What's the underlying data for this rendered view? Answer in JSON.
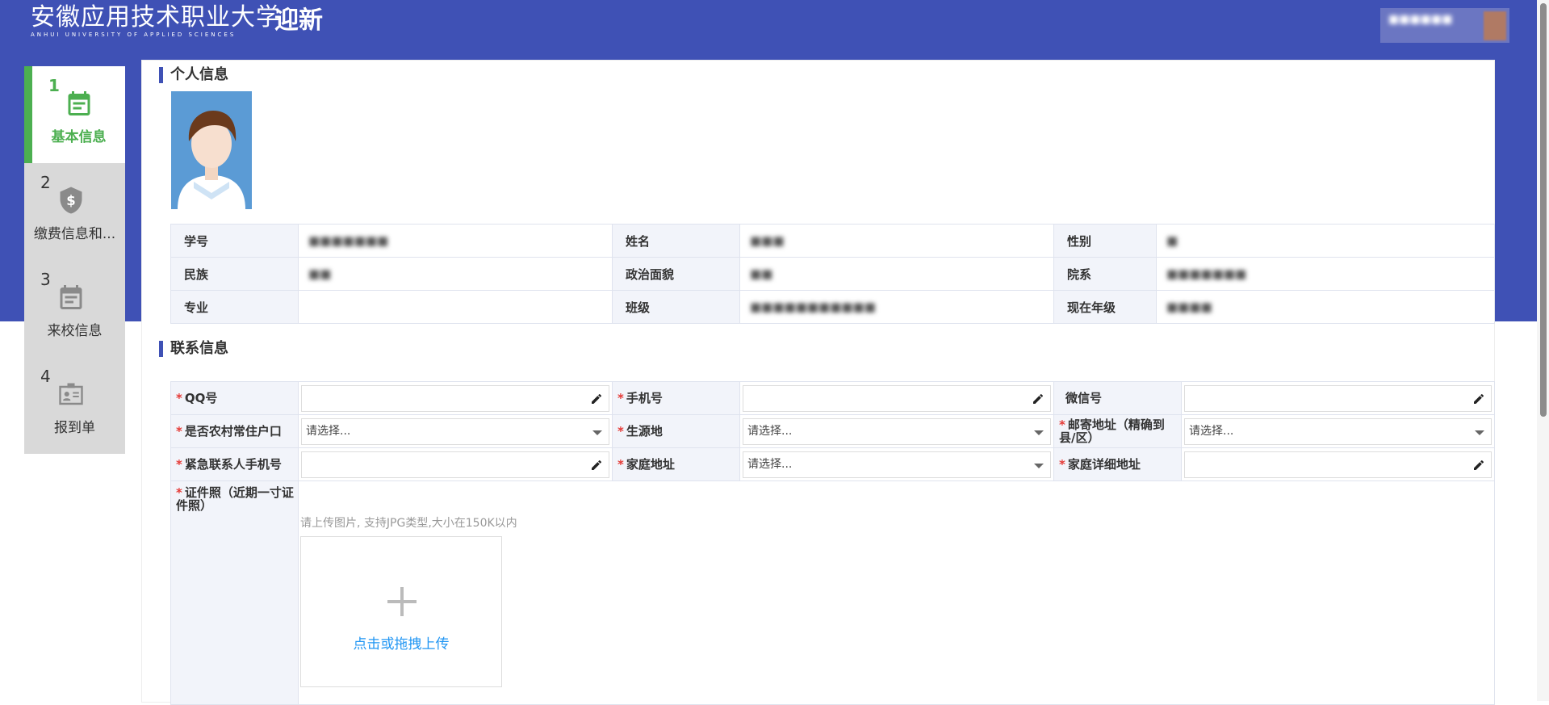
{
  "header": {
    "logo_cn": "安徽应用技术职业大学",
    "logo_en": "ANHUI UNIVERSITY OF APPLIED SCIENCES",
    "app_title": "迎新",
    "user_name": "■■■■■■",
    "brand_color": "#3f51b5"
  },
  "steps": [
    {
      "num": "1",
      "label": "基本信息",
      "icon": "calendar-icon",
      "active": true
    },
    {
      "num": "2",
      "label": "缴费信息和...",
      "icon": "shield-dollar-icon",
      "active": false
    },
    {
      "num": "3",
      "label": "来校信息",
      "icon": "calendar-icon",
      "active": false
    },
    {
      "num": "4",
      "label": "报到单",
      "icon": "id-card-icon",
      "active": false
    }
  ],
  "personal": {
    "title": "个人信息",
    "labels": {
      "student_id": "学号",
      "name": "姓名",
      "gender": "性别",
      "ethnicity": "民族",
      "political": "政治面貌",
      "department": "院系",
      "major": "专业",
      "class": "班级",
      "grade": "现在年级"
    },
    "values": {
      "student_id": "■■■■■■■",
      "name": "■■■",
      "gender": "■",
      "ethnicity": "■■",
      "political": "■■",
      "department": "■■■■■■■",
      "major": "",
      "class": "■■■■■■■■■■■",
      "grade": "■■■■"
    }
  },
  "contact": {
    "title": "联系信息",
    "labels": {
      "qq": "QQ号",
      "phone": "手机号",
      "wechat": "微信号",
      "rural": "是否农村常住户口",
      "origin": "生源地",
      "mail_addr": "邮寄地址（精确到县/区）",
      "emergency": "紧急联系人手机号",
      "home_addr": "家庭地址",
      "home_detail": "家庭详细地址",
      "id_photo": "证件照（近期一寸证件照）"
    },
    "values": {
      "qq": "",
      "phone": "",
      "wechat": "",
      "emergency": "",
      "home_detail": ""
    },
    "select_placeholder": "请选择...",
    "upload_hint": "请上传图片, 支持JPG类型,大小在150K以内",
    "upload_label": "点击或拖拽上传"
  }
}
